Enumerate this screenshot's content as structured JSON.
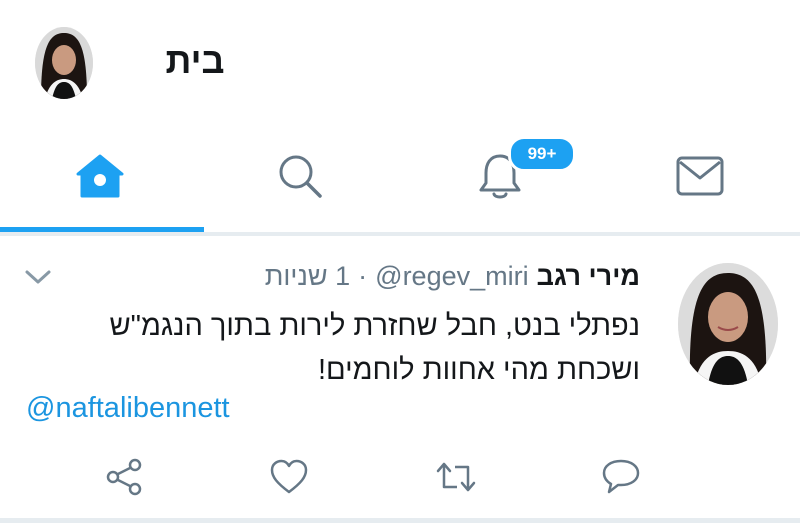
{
  "header": {
    "title": "בית",
    "avatar": "profile-avatar"
  },
  "tabs": [
    {
      "name": "home",
      "icon": "home-icon",
      "active": true
    },
    {
      "name": "search",
      "icon": "search-icon",
      "active": false
    },
    {
      "name": "notifications",
      "icon": "bell-icon",
      "badge": "99+",
      "active": false
    },
    {
      "name": "messages",
      "icon": "mail-icon",
      "active": false
    }
  ],
  "tweet": {
    "display_name": "מירי רגב",
    "handle": "@regev_miri",
    "separator": "·",
    "time": "1 שניות",
    "text_line1": "נפתלי בנט, חבל שחזרת לירות בתוך הנגמ\"ש",
    "text_line2": "ושכחת מהי אחוות לוחמים!",
    "mention": "@naftalibennett",
    "actions": [
      "share-icon",
      "heart-icon",
      "retweet-icon",
      "reply-icon"
    ]
  },
  "colors": {
    "accent": "#1da1f2",
    "icon_gray": "#657786",
    "divider": "#e6ecf0",
    "link": "#1b95e0"
  }
}
